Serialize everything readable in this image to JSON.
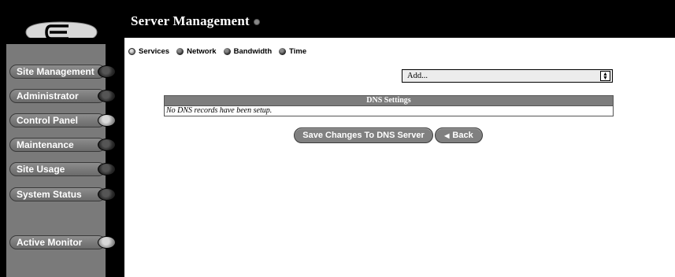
{
  "header": {
    "title": "Server Management"
  },
  "sidebar": {
    "items": [
      {
        "label": "Site Management",
        "knob": "dark"
      },
      {
        "label": "Administrator",
        "knob": "dark"
      },
      {
        "label": "Control Panel",
        "knob": "light"
      },
      {
        "label": "Maintenance",
        "knob": "dark"
      },
      {
        "label": "Site Usage",
        "knob": "dark"
      },
      {
        "label": "System Status",
        "knob": "dark"
      },
      {
        "label": "Active Monitor",
        "knob": "light"
      }
    ]
  },
  "subnav": {
    "items": [
      {
        "label": "Services",
        "active": true
      },
      {
        "label": "Network",
        "active": false
      },
      {
        "label": "Bandwidth",
        "active": false
      },
      {
        "label": "Time",
        "active": false
      }
    ]
  },
  "add_select": {
    "value": "Add..."
  },
  "dns_table": {
    "header": "DNS Settings",
    "empty_message": "No DNS records have been setup."
  },
  "buttons": {
    "save_label": "Save Changes To DNS Server",
    "back_label": "Back"
  },
  "colors": {
    "background": "#ffffff",
    "sidebar": "#000000",
    "panel": "#7a7a7a",
    "table_header": "#7d7d7d"
  }
}
